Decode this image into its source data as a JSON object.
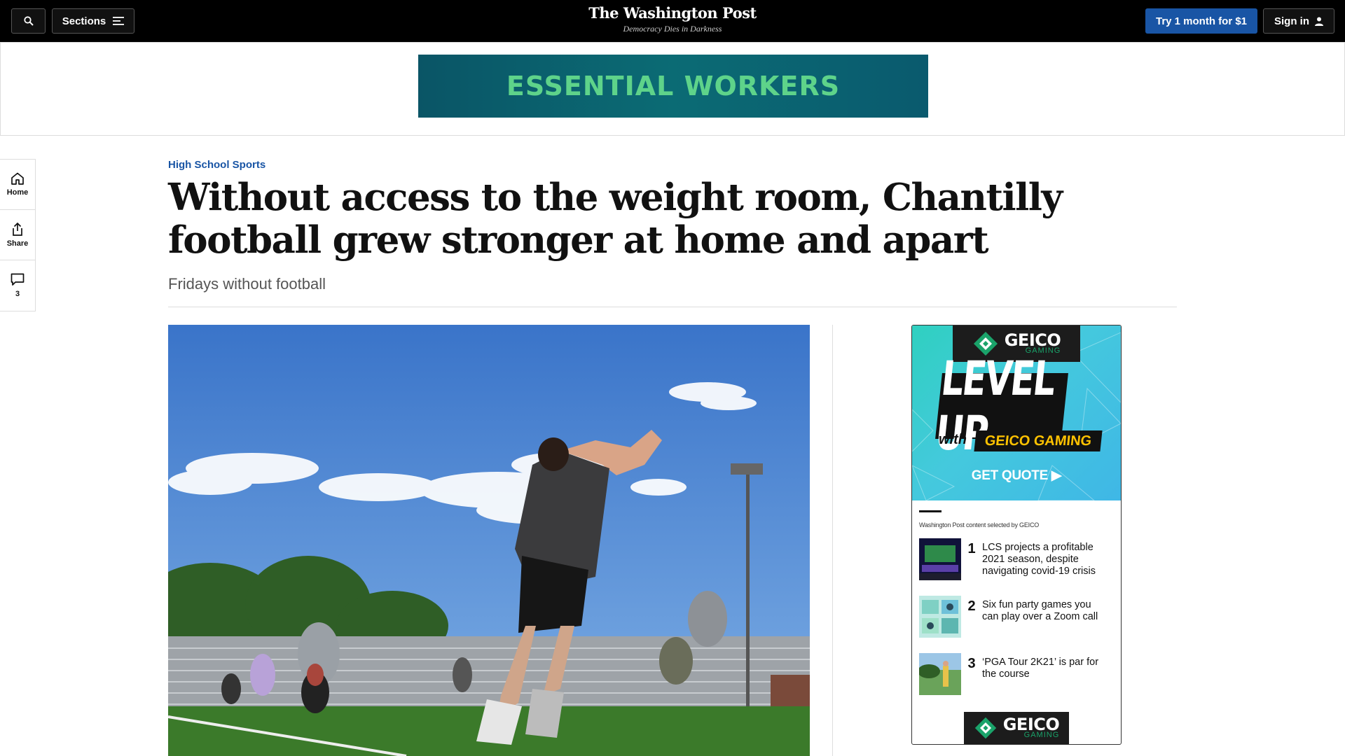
{
  "nav": {
    "search_icon": "search-icon",
    "sections_label": "Sections",
    "sections_icon": "menu-icon",
    "logo": "The Washington Post",
    "tagline": "Democracy Dies in Darkness",
    "trial_label": "Try 1 month for $1",
    "signin_label": "Sign in",
    "signin_icon": "user-icon"
  },
  "top_ad": {
    "text": "ESSENTIAL WORKERS"
  },
  "rail": {
    "home_label": "Home",
    "share_label": "Share",
    "comments_count": "3"
  },
  "article": {
    "kicker": "High School Sports",
    "headline": "Without access to the weight room, Chantilly football grew stronger at home and apart",
    "dek": "Fridays without football"
  },
  "side_ad": {
    "brand": "GEICO",
    "brand_sub": "GAMING",
    "headline": "LEVEL UP",
    "with": "with",
    "pill": "GEICO GAMING",
    "cta": "GET QUOTE ▶",
    "credit": "Washington Post content selected by GEICO",
    "items": [
      {
        "num": "1",
        "title": "LCS projects a profitable 2021 season, despite navigating covid-19 crisis"
      },
      {
        "num": "2",
        "title": "Six fun party games you can play over a Zoom call"
      },
      {
        "num": "3",
        "title": "‘PGA Tour 2K21’ is par for the course"
      }
    ]
  },
  "colors": {
    "nav_bg": "#000000",
    "accent_blue": "#1955a5",
    "banner_text": "#5ed38a",
    "sky": "#3d79c9",
    "turf": "#3b7a2a"
  }
}
